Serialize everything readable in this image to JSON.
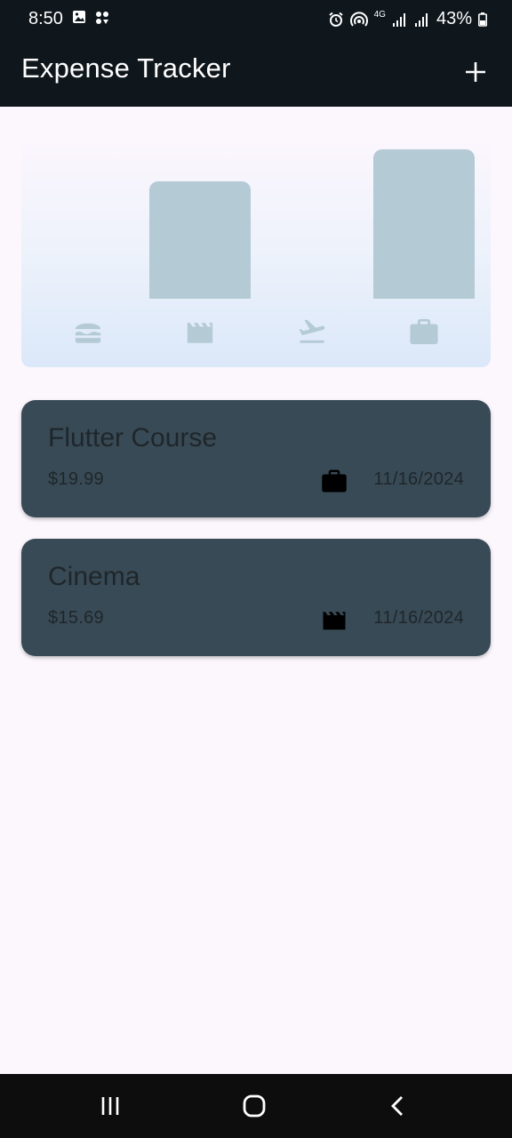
{
  "status_bar": {
    "time": "8:50",
    "battery": "43%",
    "network": "4G"
  },
  "app_bar": {
    "title": "Expense Tracker",
    "add_icon": "plus-icon"
  },
  "chart_data": {
    "type": "bar",
    "categories": [
      "food",
      "leisure",
      "travel",
      "work"
    ],
    "values": [
      0,
      15.69,
      0,
      19.99
    ],
    "icons": [
      "hamburger-icon",
      "clapperboard-icon",
      "airplane-takeoff-icon",
      "briefcase-icon"
    ],
    "bar_color": "#b4cad4"
  },
  "expenses": [
    {
      "title": "Flutter Course",
      "amount": "$19.99",
      "category_icon": "briefcase-icon",
      "date": "11/16/2024"
    },
    {
      "title": "Cinema",
      "amount": "$15.69",
      "category_icon": "clapperboard-icon",
      "date": "11/16/2024"
    }
  ],
  "colors": {
    "app_bar": "#0f161c",
    "background": "#fcf6fd",
    "card": "#384a55",
    "card_text": "#1f262b"
  },
  "nav_bar": {
    "icons": [
      "recent-apps-icon",
      "home-icon",
      "back-icon"
    ]
  }
}
